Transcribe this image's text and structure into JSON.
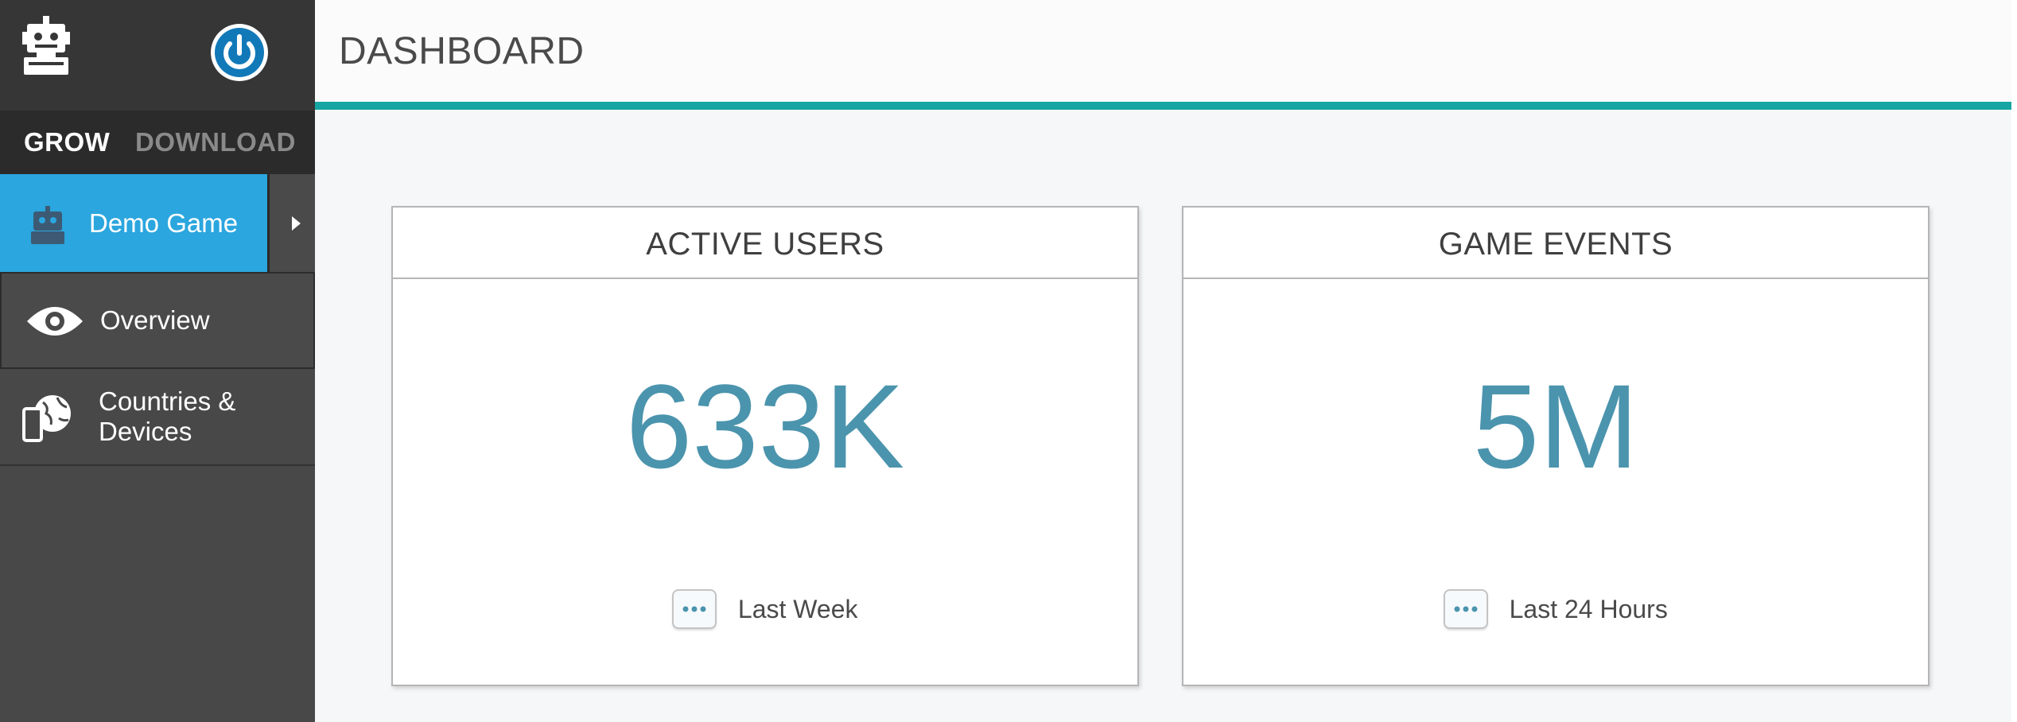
{
  "sidebar": {
    "mode_tabs": [
      {
        "label": "GROW",
        "active": true
      },
      {
        "label": "DOWNLOAD",
        "active": false
      }
    ],
    "game": {
      "label": "Demo Game",
      "icon": "robot-icon"
    },
    "nav": [
      {
        "label": "Overview",
        "icon": "eye-icon"
      },
      {
        "label": "Countries & Devices",
        "icon": "globe-device-icon"
      }
    ]
  },
  "header": {
    "title": "DASHBOARD"
  },
  "cards": [
    {
      "title": "ACTIVE USERS",
      "value": "633K",
      "period": "Last Week"
    },
    {
      "title": "GAME EVENTS",
      "value": "5M",
      "period": "Last 24 Hours"
    }
  ],
  "colors": {
    "sidebar_bg": "#484848",
    "sidebar_top": "#363636",
    "tabs_bg": "#2b2b2b",
    "active_game": "#2ba6de",
    "header_accent": "#15a5a2",
    "metric_value": "#4b94ad",
    "power_blue": "#1279b9"
  }
}
